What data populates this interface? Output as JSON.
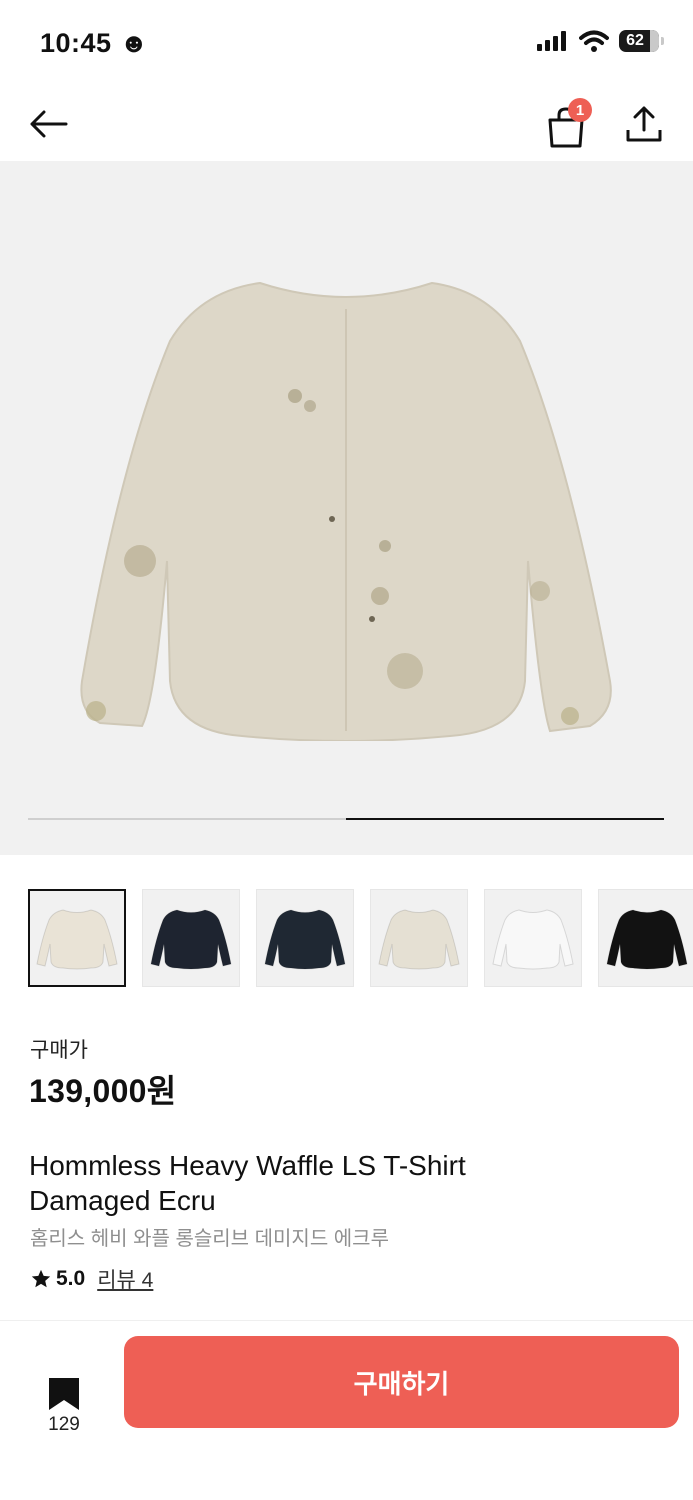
{
  "status_bar": {
    "time": "10:45",
    "time_emoji": "☻",
    "battery": "62"
  },
  "nav": {
    "cart_count": "1"
  },
  "hero": {
    "image_progress": 0.5
  },
  "thumbnails": [
    {
      "color": "#e9e3d6",
      "selected": true
    },
    {
      "color": "#1e2430",
      "selected": false
    },
    {
      "color": "#1f2833",
      "selected": false
    },
    {
      "color": "#e5e0d3",
      "selected": false
    },
    {
      "color": "#f8f8f8",
      "selected": false
    },
    {
      "color": "#121212",
      "selected": false
    }
  ],
  "product": {
    "price_label": "구매가",
    "price": "139,000원",
    "name_line1": "Hommless Heavy Waffle LS T-Shirt",
    "name_line2": "Damaged Ecru",
    "name_ko": "홈리스 헤비 와플 롱슬리브 데미지드 에크루",
    "rating": "5.0",
    "review_link": "리뷰 4"
  },
  "bottom_bar": {
    "bookmark_count": "129",
    "buy_label": "구매하기"
  },
  "colors": {
    "accent": "#ee5f55"
  }
}
